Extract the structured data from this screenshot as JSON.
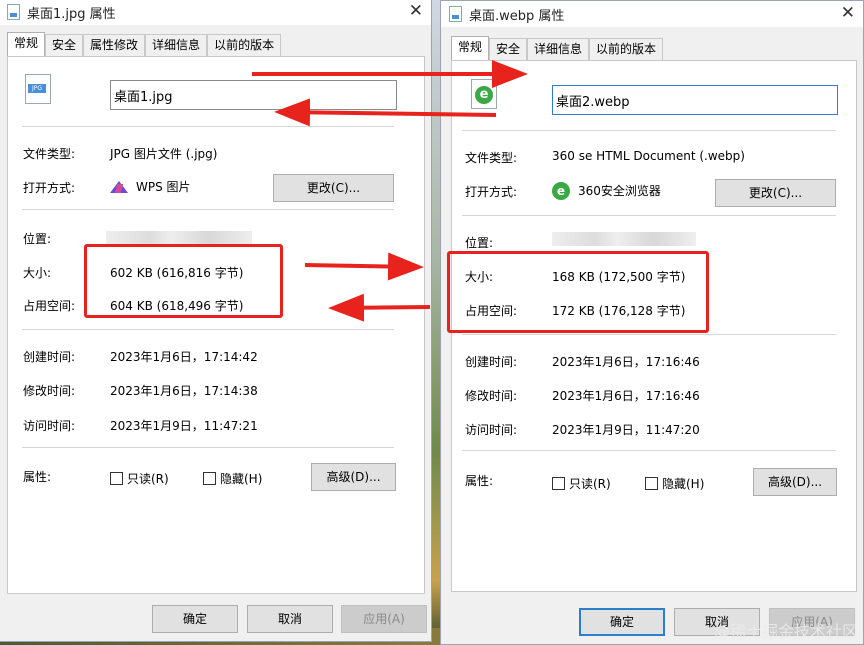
{
  "left": {
    "title": "桌面1.jpg 属性",
    "tabs": [
      "常规",
      "安全",
      "属性修改",
      "详细信息",
      "以前的版本"
    ],
    "file_name": "桌面1.jpg",
    "file_icon_badge": "JPG",
    "type_label": "文件类型:",
    "type_value": "JPG 图片文件 (.jpg)",
    "open_label": "打开方式:",
    "open_value": "WPS 图片",
    "change_button": "更改(C)...",
    "location_label": "位置:",
    "size_label": "大小:",
    "size_value": "602 KB (616,816 字节)",
    "disk_label": "占用空间:",
    "disk_value": "604 KB (618,496 字节)",
    "created_label": "创建时间:",
    "created_value": "2023年1月6日，17:14:42",
    "modified_label": "修改时间:",
    "modified_value": "2023年1月6日，17:14:38",
    "accessed_label": "访问时间:",
    "accessed_value": "2023年1月9日，11:47:21",
    "attr_label": "属性:",
    "readonly_label": "只读(R)",
    "hidden_label": "隐藏(H)",
    "advanced_button": "高级(D)...",
    "ok_button": "确定",
    "cancel_button": "取消",
    "apply_button": "应用(A)"
  },
  "right": {
    "title": "桌面.webp 属性",
    "tabs": [
      "常规",
      "安全",
      "详细信息",
      "以前的版本"
    ],
    "file_name": "桌面2.webp",
    "file_icon_badge": "e",
    "type_label": "文件类型:",
    "type_value": "360 se HTML Document (.webp)",
    "open_label": "打开方式:",
    "open_value": "360安全浏览器",
    "open_icon_badge": "e",
    "change_button": "更改(C)...",
    "location_label": "位置:",
    "size_label": "大小:",
    "size_value": "168 KB (172,500 字节)",
    "disk_label": "占用空间:",
    "disk_value": "172 KB (176,128 字节)",
    "created_label": "创建时间:",
    "created_value": "2023年1月6日，17:16:46",
    "modified_label": "修改时间:",
    "modified_value": "2023年1月6日，17:16:46",
    "accessed_label": "访问时间:",
    "accessed_value": "2023年1月9日，11:47:20",
    "attr_label": "属性:",
    "readonly_label": "只读(R)",
    "hidden_label": "隐藏(H)",
    "advanced_button": "高级(D)...",
    "ok_button": "确定",
    "cancel_button": "取消",
    "apply_button": "应用(A)"
  },
  "watermark": "@稀土掘金技术社区",
  "colors": {
    "annotation_red": "#e8231d",
    "focus_blue": "#2a7fcf"
  },
  "icons": [
    "close-icon",
    "jpg-file-icon",
    "webp-file-icon",
    "wps-icon",
    "360-browser-icon"
  ]
}
